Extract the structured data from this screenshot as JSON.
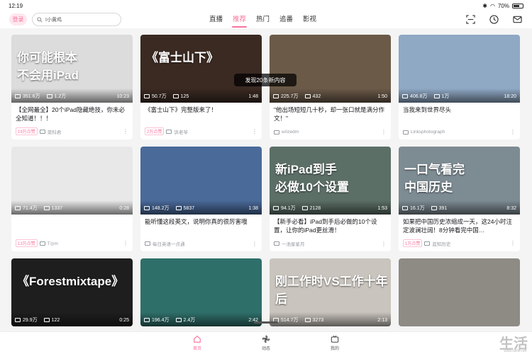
{
  "status": {
    "time": "12:19",
    "network": "5.40\nKB/s",
    "battery": "70%",
    "battery_level": 0.7
  },
  "header": {
    "login": "登录",
    "search_value": "I小黄鸡",
    "tabs": [
      {
        "label": "直播",
        "active": false
      },
      {
        "label": "推荐",
        "active": true
      },
      {
        "label": "热门",
        "active": false
      },
      {
        "label": "追番",
        "active": false
      },
      {
        "label": "影视",
        "active": false
      }
    ],
    "icons": [
      "scan-icon",
      "history-icon",
      "message-icon"
    ]
  },
  "toast": "发现20条新内容",
  "cards": [
    {
      "views": "351.6万",
      "danmaku": "1.2万",
      "duration": "10:23",
      "caption": "你可能根本\n不会用iPad",
      "title": "【全网最全】20个iPad隐藏绝技，你未必全知道！！！",
      "badge": "19万点赞",
      "up": "菜科君",
      "thumb_color": "#dcdcdc"
    },
    {
      "views": "50.7万",
      "danmaku": "125",
      "duration": "1:48",
      "caption": "《富士山下》",
      "title": "《富士山下》完整版来了！",
      "badge": "2万点赞",
      "up": "诉老爷",
      "thumb_color": "#3a2a22"
    },
    {
      "views": "225.7万",
      "danmaku": "432",
      "duration": "1:50",
      "caption": "",
      "title": "\"他出场短短几十秒，却一张口就是满分作文！\"",
      "badge": "",
      "up": "wrizedm",
      "thumb_color": "#6b5a48"
    },
    {
      "views": "406.8万",
      "danmaku": "1万",
      "duration": "18:20",
      "caption": "",
      "title": "当我来到世界尽头",
      "badge": "",
      "up": "Linksphotograph",
      "thumb_color": "#8fa8c4"
    },
    {
      "views": "71.4万",
      "danmaku": "1337",
      "duration": "0:28",
      "caption": "",
      "title": "",
      "badge": "13万点赞",
      "up": "T◎m",
      "thumb_color": "#e8e8e8"
    },
    {
      "views": "148.2万",
      "danmaku": "5837",
      "duration": "1:38",
      "caption": "",
      "title": "能听懂这段英文，说明你真的很厉害哦",
      "badge": "",
      "up": "每日英语一点通",
      "thumb_color": "#4a6a9a"
    },
    {
      "views": "94.1万",
      "danmaku": "2128",
      "duration": "1:53",
      "caption": "新iPad到手\n必做10个设置",
      "title": "【新手必看】iPad到手后必做的10个设置，让你的iPad更丝滑！",
      "badge": "",
      "up": "一池星星月",
      "thumb_color": "#5c6f66"
    },
    {
      "views": "16.1万",
      "danmaku": "391",
      "duration": "8:32",
      "caption": "一口气看完\n中国历史",
      "title": "如果把中国历史浓缩成一天，这24小时注定波澜壮阔！8分钟看完中国…",
      "badge": "1万点赞",
      "up": "蓝知历史",
      "thumb_color": "#7d8b93"
    },
    {
      "views": "29.9万",
      "danmaku": "122",
      "duration": "0:25",
      "caption": "《Forestmixtape》",
      "title": "",
      "badge": "",
      "up": "",
      "thumb_color": "#1e1e1e"
    },
    {
      "views": "196.4万",
      "danmaku": "2.4万",
      "duration": "2:42",
      "caption": "",
      "title": "",
      "badge": "",
      "up": "",
      "thumb_color": "#2f6f6a"
    },
    {
      "views": "514.7万",
      "danmaku": "3273",
      "duration": "2:13",
      "caption": "刚工作时VS工作十年后",
      "title": "",
      "badge": "",
      "up": "",
      "thumb_color": "#c9c4bd"
    },
    {
      "views": "",
      "danmaku": "",
      "duration": "",
      "caption": "",
      "title": "",
      "badge": "",
      "up": "",
      "thumb_color": "#8e8a84"
    }
  ],
  "bottom_nav": [
    {
      "label": "首页",
      "active": true,
      "icon": "home-icon"
    },
    {
      "label": "动态",
      "active": false,
      "icon": "pinwheel-icon"
    },
    {
      "label": "我的",
      "active": false,
      "icon": "tv-icon"
    }
  ],
  "watermark": {
    "text": "生活",
    "url": "www.sslife.net"
  },
  "accent": "#fb7299"
}
